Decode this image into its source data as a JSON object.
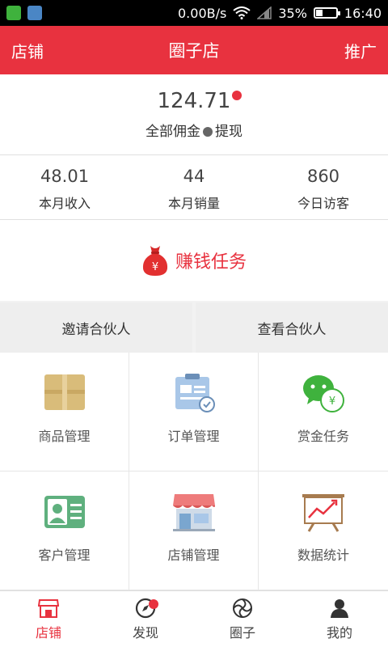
{
  "status_bar": {
    "network_speed": "0.00B/s",
    "battery": "35%",
    "battery_level": 0.35,
    "time": "16:40"
  },
  "header": {
    "left": "店铺",
    "title": "圈子店",
    "right": "推广"
  },
  "commission": {
    "amount": "124.71",
    "label_prefix": "全部佣金",
    "label_suffix": "提现"
  },
  "stats": [
    {
      "value": "48.01",
      "label": "本月收入"
    },
    {
      "value": "44",
      "label": "本月销量"
    },
    {
      "value": "860",
      "label": "今日访客"
    }
  ],
  "task": {
    "label": "赚钱任务",
    "icon": "money-bag-icon"
  },
  "partners": {
    "invite": "邀请合伙人",
    "view": "查看合伙人"
  },
  "grid": [
    {
      "label": "商品管理",
      "icon": "box-icon"
    },
    {
      "label": "订单管理",
      "icon": "clipboard-icon"
    },
    {
      "label": "赏金任务",
      "icon": "wechat-icon"
    },
    {
      "label": "客户管理",
      "icon": "id-card-icon"
    },
    {
      "label": "店铺管理",
      "icon": "storefront-icon"
    },
    {
      "label": "数据统计",
      "icon": "chart-board-icon"
    }
  ],
  "bottom_nav": [
    {
      "label": "店铺",
      "icon": "shop-icon",
      "active": true
    },
    {
      "label": "发现",
      "icon": "compass-icon",
      "badge": true
    },
    {
      "label": "圈子",
      "icon": "circle-icon"
    },
    {
      "label": "我的",
      "icon": "person-icon"
    }
  ],
  "colors": {
    "accent": "#e8323f",
    "background": "#f2f2f2"
  }
}
